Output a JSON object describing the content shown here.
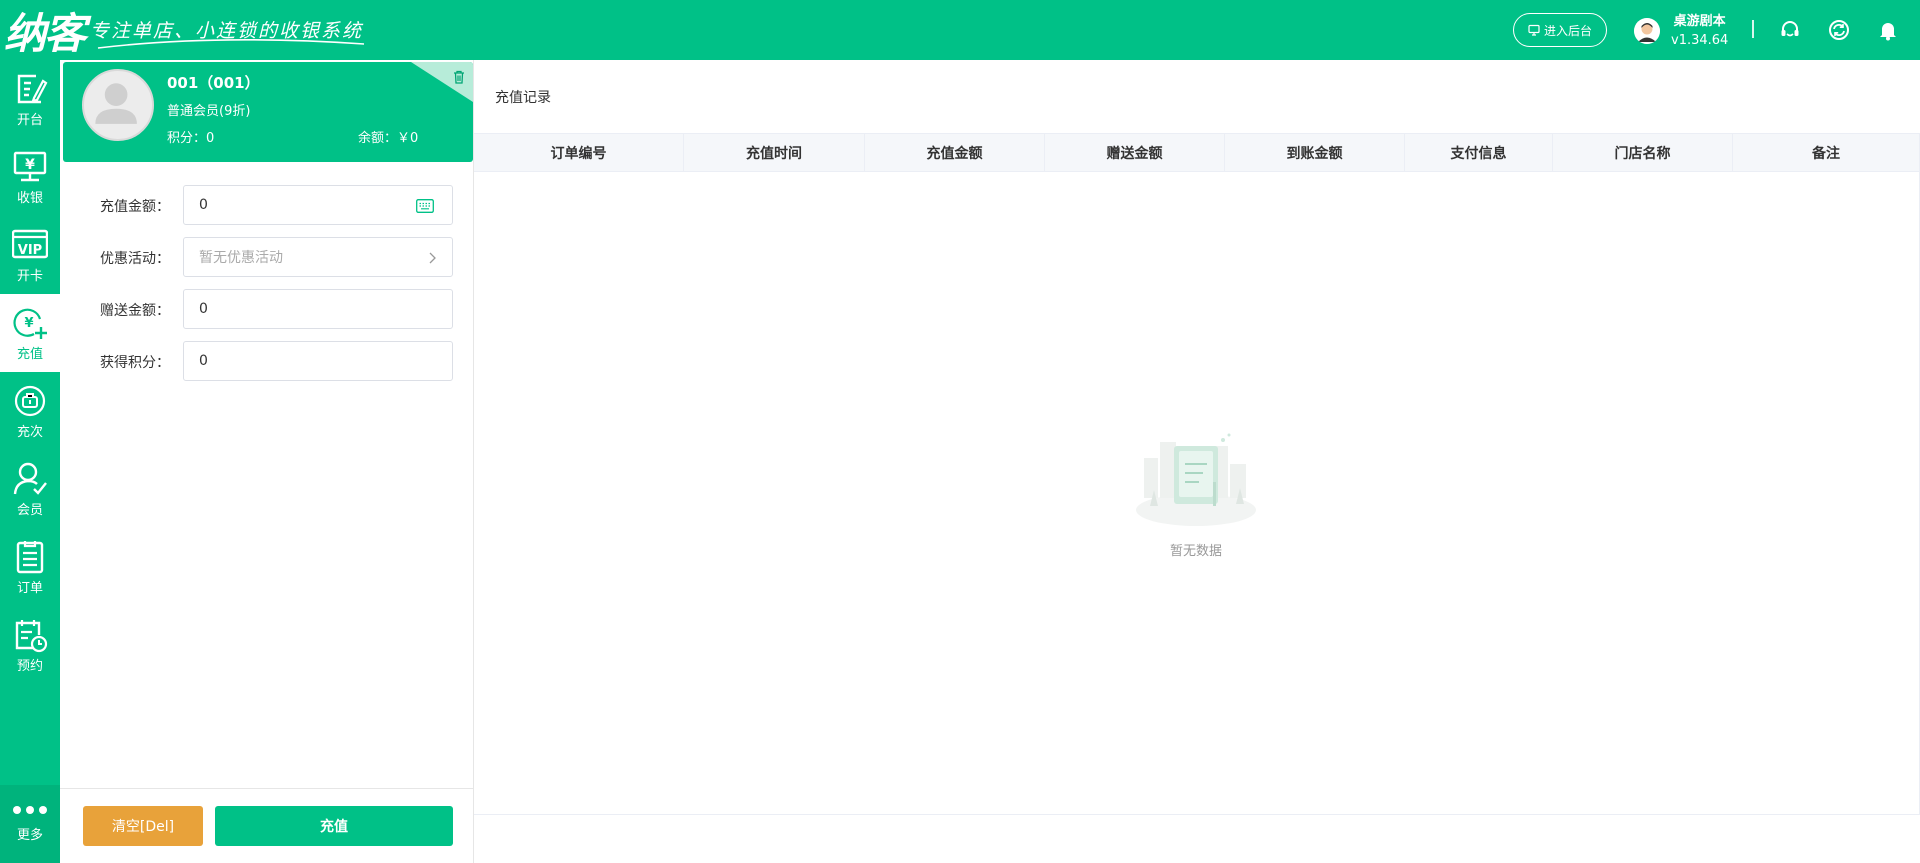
{
  "header": {
    "logo": "纳客",
    "slogan": "专注单店、小连锁的收银系统",
    "backend_button": "进入后台",
    "user_name": "桌游剧本",
    "version": "v1.34.64",
    "icons": [
      "headset-icon",
      "sync-icon",
      "bell-icon"
    ]
  },
  "sidebar": {
    "items": [
      {
        "label": "开台",
        "icon": "open-table-icon"
      },
      {
        "label": "收银",
        "icon": "cashier-icon"
      },
      {
        "label": "开卡",
        "icon": "vip-card-icon"
      },
      {
        "label": "充值",
        "icon": "recharge-icon",
        "active": true
      },
      {
        "label": "充次",
        "icon": "count-recharge-icon"
      },
      {
        "label": "会员",
        "icon": "member-icon"
      },
      {
        "label": "订单",
        "icon": "order-icon"
      },
      {
        "label": "预约",
        "icon": "reservation-icon"
      }
    ],
    "more_label": "更多"
  },
  "member": {
    "name": "001（001）",
    "level": "普通会员(9折)",
    "points": "积分：0",
    "balance": "余额：￥0"
  },
  "form": {
    "amount_label": "充值金额：",
    "amount_value": "0",
    "promo_label": "优惠活动：",
    "promo_placeholder": "暂无优惠活动",
    "gift_label": "赠送金额：",
    "gift_value": "0",
    "points_label": "获得积分：",
    "points_value": "0"
  },
  "footer": {
    "clear_button": "清空[Del]",
    "charge_button": "充值"
  },
  "records": {
    "title": "充值记录",
    "columns": [
      "订单编号",
      "充值时间",
      "充值金额",
      "赠送金额",
      "到账金额",
      "支付信息",
      "门店名称",
      "备注"
    ],
    "rows": [],
    "empty_text": "暂无数据"
  },
  "colors": {
    "brand": "#00c187",
    "clear_button": "#e8a23a",
    "header_bg": "#f5f7fa"
  }
}
